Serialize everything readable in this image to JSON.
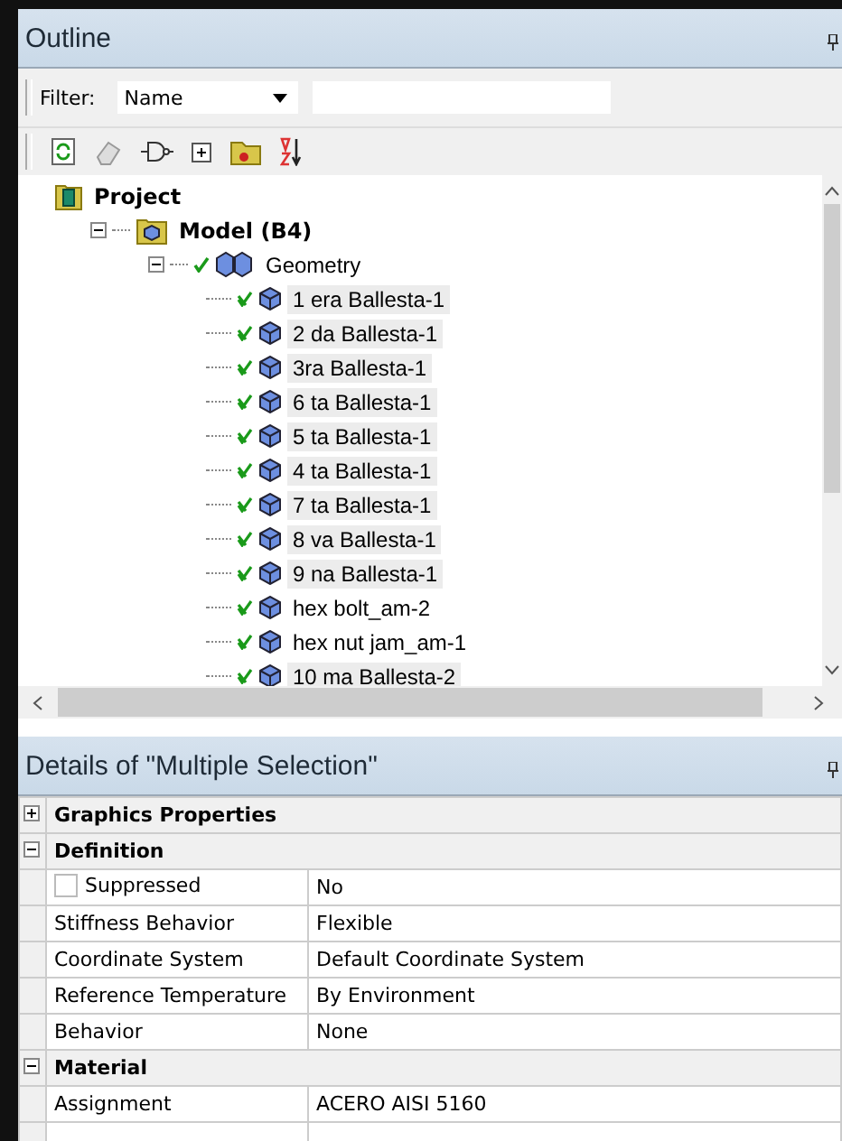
{
  "outline": {
    "title": "Outline",
    "filter": {
      "label": "Filter:",
      "value": "Name"
    },
    "tree": [
      {
        "label": "Project",
        "kind": "project",
        "children": [
          {
            "label": "Model (B4)",
            "kind": "model",
            "expanded": true,
            "children": [
              {
                "label": "Geometry",
                "kind": "geometry",
                "expanded": true,
                "children": [
                  {
                    "label": "1 era Ballesta-1",
                    "kind": "part",
                    "selected": true
                  },
                  {
                    "label": "2 da Ballesta-1",
                    "kind": "part",
                    "selected": true
                  },
                  {
                    "label": "3ra Ballesta-1",
                    "kind": "part",
                    "selected": true
                  },
                  {
                    "label": "6 ta Ballesta-1",
                    "kind": "part",
                    "selected": true
                  },
                  {
                    "label": "5 ta Ballesta-1",
                    "kind": "part",
                    "selected": true
                  },
                  {
                    "label": "4 ta Ballesta-1",
                    "kind": "part",
                    "selected": true
                  },
                  {
                    "label": "7 ta Ballesta-1",
                    "kind": "part",
                    "selected": true
                  },
                  {
                    "label": "8 va Ballesta-1",
                    "kind": "part",
                    "selected": true
                  },
                  {
                    "label": "9 na Ballesta-1",
                    "kind": "part",
                    "selected": true
                  },
                  {
                    "label": "hex bolt_am-2",
                    "kind": "part",
                    "selected": false
                  },
                  {
                    "label": "hex nut jam_am-1",
                    "kind": "part",
                    "selected": false
                  },
                  {
                    "label": "10 ma Ballesta-2",
                    "kind": "part",
                    "selected": true
                  }
                ]
              }
            ]
          }
        ]
      }
    ]
  },
  "details": {
    "title": "Details of \"Multiple Selection\"",
    "sections": [
      {
        "title": "Graphics Properties",
        "expanded": false
      },
      {
        "title": "Definition",
        "expanded": true,
        "rows": [
          {
            "name": "Suppressed",
            "value": "No",
            "kind": "checkbox",
            "checked": false
          },
          {
            "name": "Stiffness Behavior",
            "value": "Flexible",
            "kind": "text"
          },
          {
            "name": "Coordinate System",
            "value": "Default Coordinate System",
            "kind": "text"
          },
          {
            "name": "Reference Temperature",
            "value": "By Environment",
            "kind": "text"
          },
          {
            "name": "Behavior",
            "value": "None",
            "kind": "text"
          }
        ]
      },
      {
        "title": "Material",
        "expanded": true,
        "rows": [
          {
            "name": "Assignment",
            "value": "ACERO AISI 5160",
            "kind": "text"
          }
        ]
      }
    ]
  }
}
